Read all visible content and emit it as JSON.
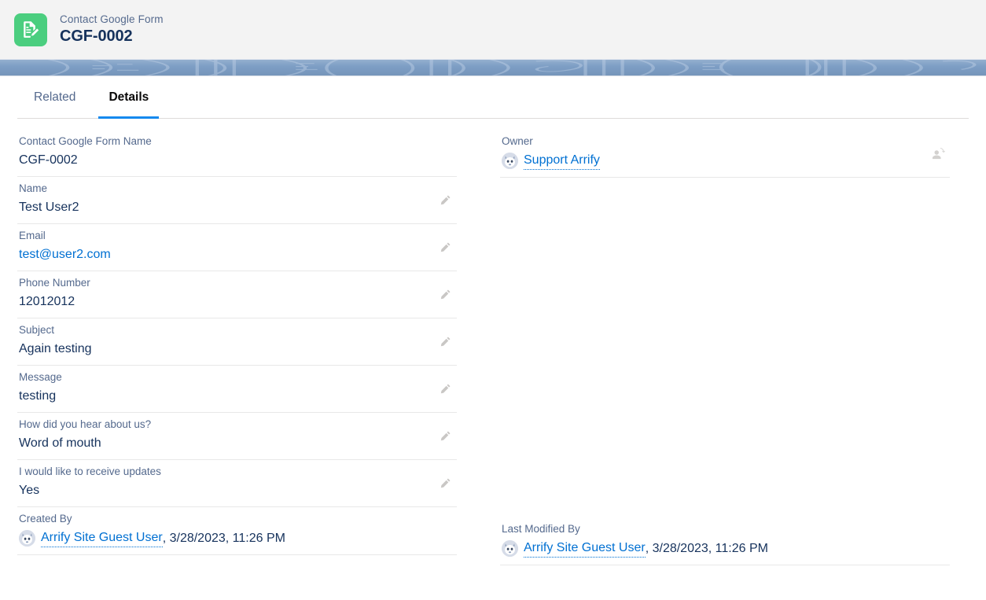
{
  "header": {
    "icon": "google-form-record-icon",
    "eyebrow": "Contact Google Form",
    "title": "CGF-0002",
    "icon_color": "#4bce7f"
  },
  "tabs": [
    {
      "label": "Related",
      "active": false
    },
    {
      "label": "Details",
      "active": true
    }
  ],
  "theme": {
    "link_color": "#0070d2",
    "active_tab_underline": "#1589ee",
    "label_color": "#54698d",
    "value_color": "#16325c",
    "banner_color": "#7c9dc4"
  },
  "details": {
    "left_column": [
      {
        "label": "Contact Google Form Name",
        "value": "CGF-0002",
        "type": "text",
        "action": "none"
      },
      {
        "label": "Name",
        "value": "Test User2",
        "type": "text",
        "action": "edit"
      },
      {
        "label": "Email",
        "value": "test@user2.com",
        "type": "link",
        "action": "edit"
      },
      {
        "label": "Phone Number",
        "value": "12012012",
        "type": "text",
        "action": "edit"
      },
      {
        "label": "Subject",
        "value": "Again testing",
        "type": "text",
        "action": "edit"
      },
      {
        "label": "Message",
        "value": "testing",
        "type": "text",
        "action": "edit"
      },
      {
        "label": "How did you hear about us?",
        "value": "Word of mouth",
        "type": "text",
        "action": "edit"
      },
      {
        "label": "I would like to receive updates",
        "value": "Yes",
        "type": "text",
        "action": "edit"
      },
      {
        "label": "Created By",
        "value": "Arrify Site Guest User",
        "meta": ", 3/28/2023, 11:26 PM",
        "type": "user",
        "action": "none"
      }
    ],
    "right_column": [
      {
        "label": "Owner",
        "value": "Support Arrify",
        "type": "user",
        "action": "change-owner"
      },
      {
        "label": "Last Modified By",
        "value": "Arrify Site Guest User",
        "meta": ", 3/28/2023, 11:26 PM",
        "type": "user",
        "action": "none"
      }
    ]
  },
  "icons": {
    "edit": "pencil-icon",
    "change_owner": "change-owner-icon",
    "avatar": "user-avatar-icon"
  }
}
